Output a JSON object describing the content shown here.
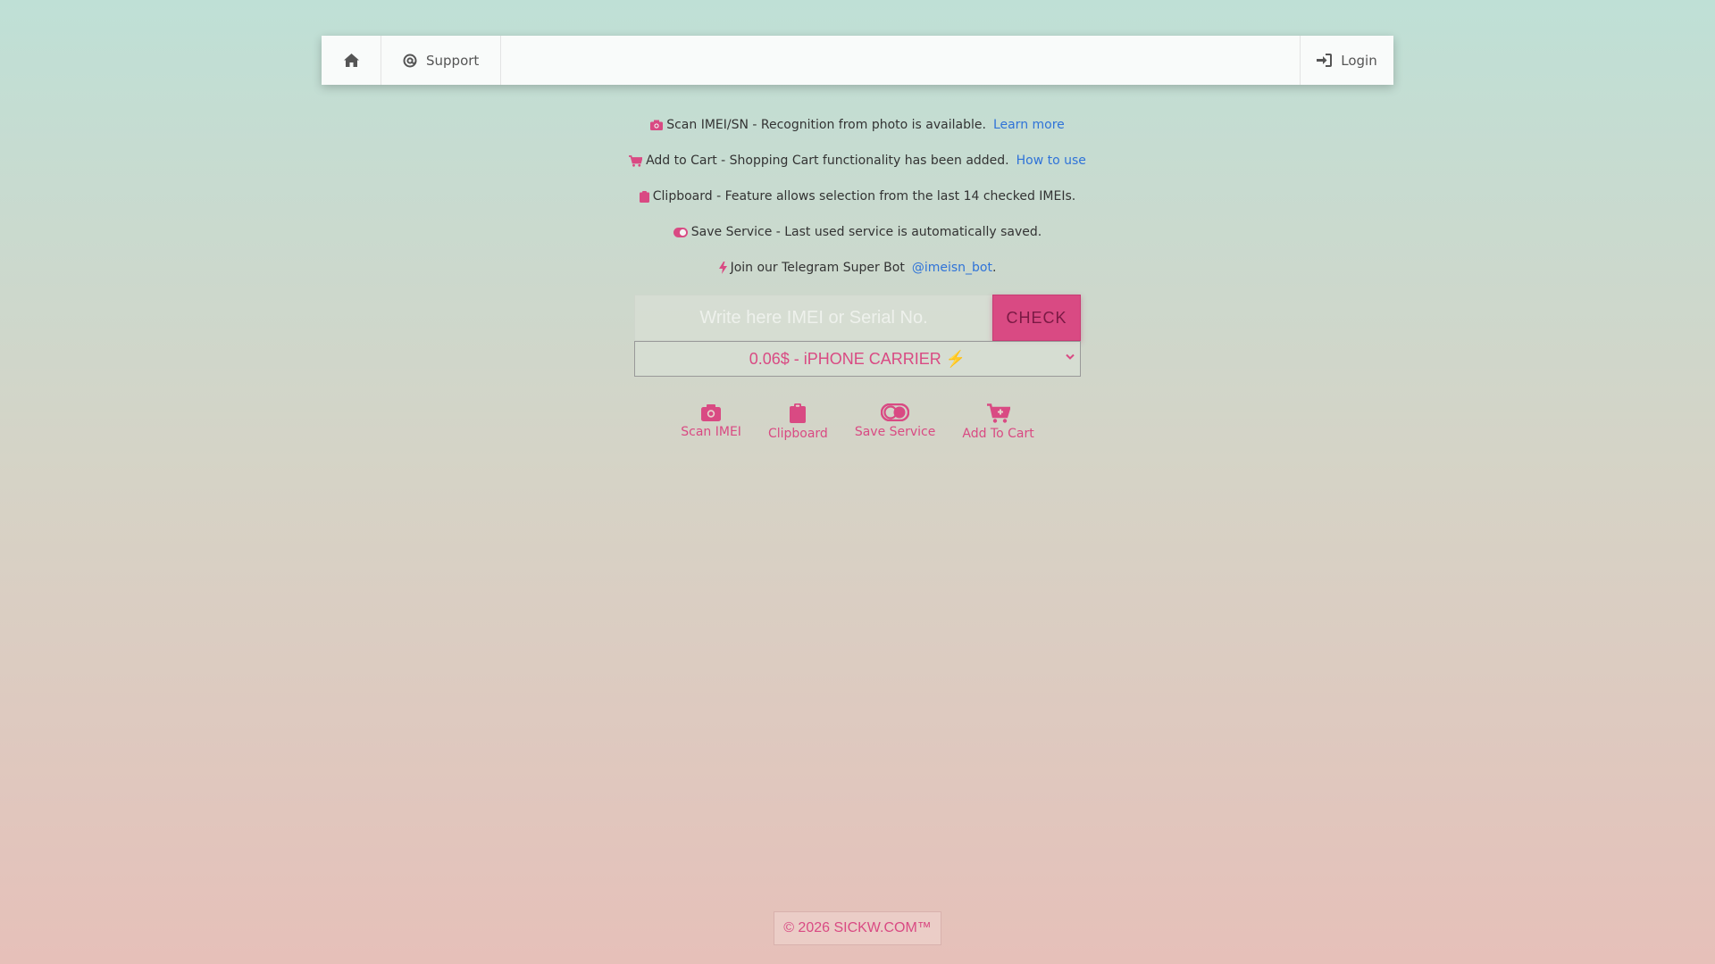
{
  "nav": {
    "home_icon": "home-icon",
    "support_label": "Support",
    "login_label": "Login"
  },
  "notices": [
    {
      "icon": "camera-icon",
      "text": "Scan IMEI/SN - Recognition from photo is available.",
      "link": "Learn more"
    },
    {
      "icon": "cart-icon",
      "text": "Add to Cart - Shopping Cart functionality has been added.",
      "link": "How to use"
    },
    {
      "icon": "clipboard-icon",
      "text": "Clipboard - Feature allows selection from the last 14 checked IMEIs.",
      "link": ""
    },
    {
      "icon": "toggle-icon",
      "text": "Save Service - Last used service is automatically saved.",
      "link": ""
    },
    {
      "icon": "bolt-icon",
      "text": "Join our Telegram Super Bot",
      "link": "@imeisn_bot",
      "suffix": "."
    }
  ],
  "form": {
    "placeholder": "Write here IMEI or Serial No.",
    "check_label": "CHECK",
    "selected_service": "0.06$ - iPHONE CARRIER ⚡"
  },
  "tools": [
    {
      "icon": "camera-icon",
      "label": "Scan IMEI"
    },
    {
      "icon": "clipboard-icon",
      "label": "Clipboard"
    },
    {
      "icon": "toggle-icon",
      "label": "Save Service"
    },
    {
      "icon": "cart-plus-icon",
      "label": "Add To Cart"
    }
  ],
  "footer": {
    "text": "© 2026 SICKW.COM™"
  },
  "colors": {
    "accent": "#d94a83",
    "link": "#2f73d8"
  }
}
